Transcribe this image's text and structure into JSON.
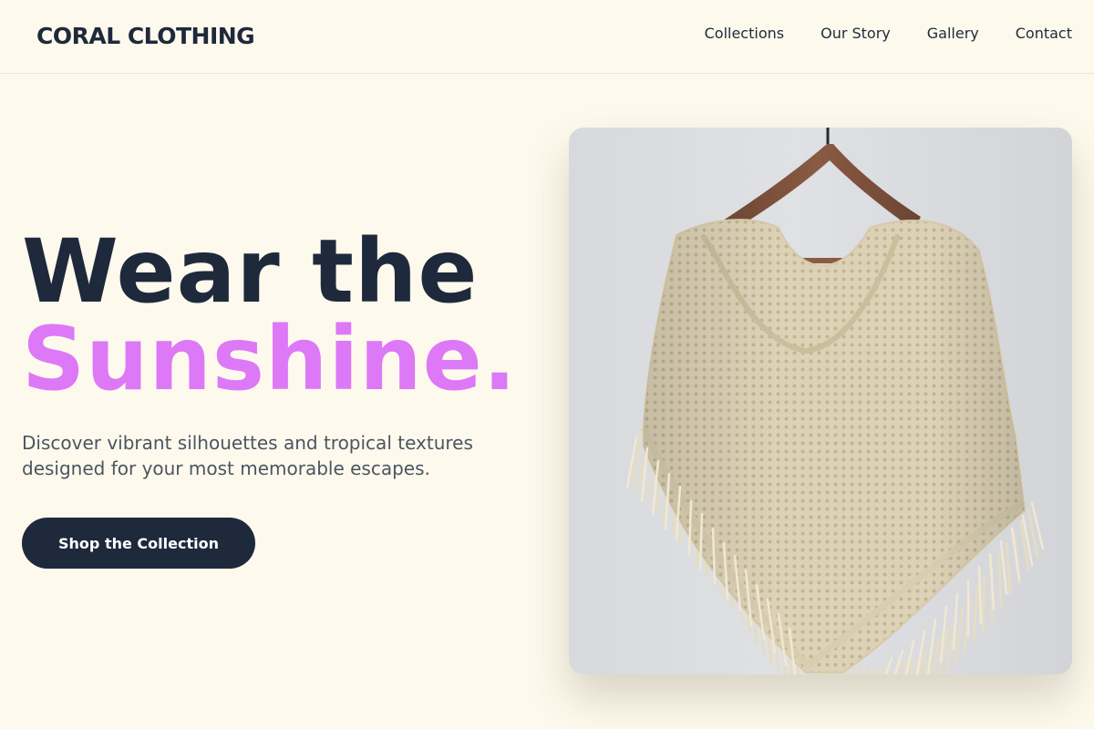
{
  "brand": {
    "name": "CORAL CLOTHING"
  },
  "nav": {
    "items": [
      {
        "label": "Collections"
      },
      {
        "label": "Our Story"
      },
      {
        "label": "Gallery"
      },
      {
        "label": "Contact"
      }
    ]
  },
  "hero": {
    "title_line1": "Wear the",
    "title_line2": "Sunshine.",
    "subtitle": "Discover vibrant silhouettes and tropical textures designed for your most memorable escapes.",
    "cta_label": "Shop the Collection"
  },
  "colors": {
    "background": "#fdf9ec",
    "text_primary": "#1e293b",
    "accent": "#dd78f7",
    "button_bg": "#1e293b",
    "button_text": "#ffffff"
  },
  "product_image": {
    "subject": "cream crochet poncho with fringe on a wooden hanger"
  }
}
